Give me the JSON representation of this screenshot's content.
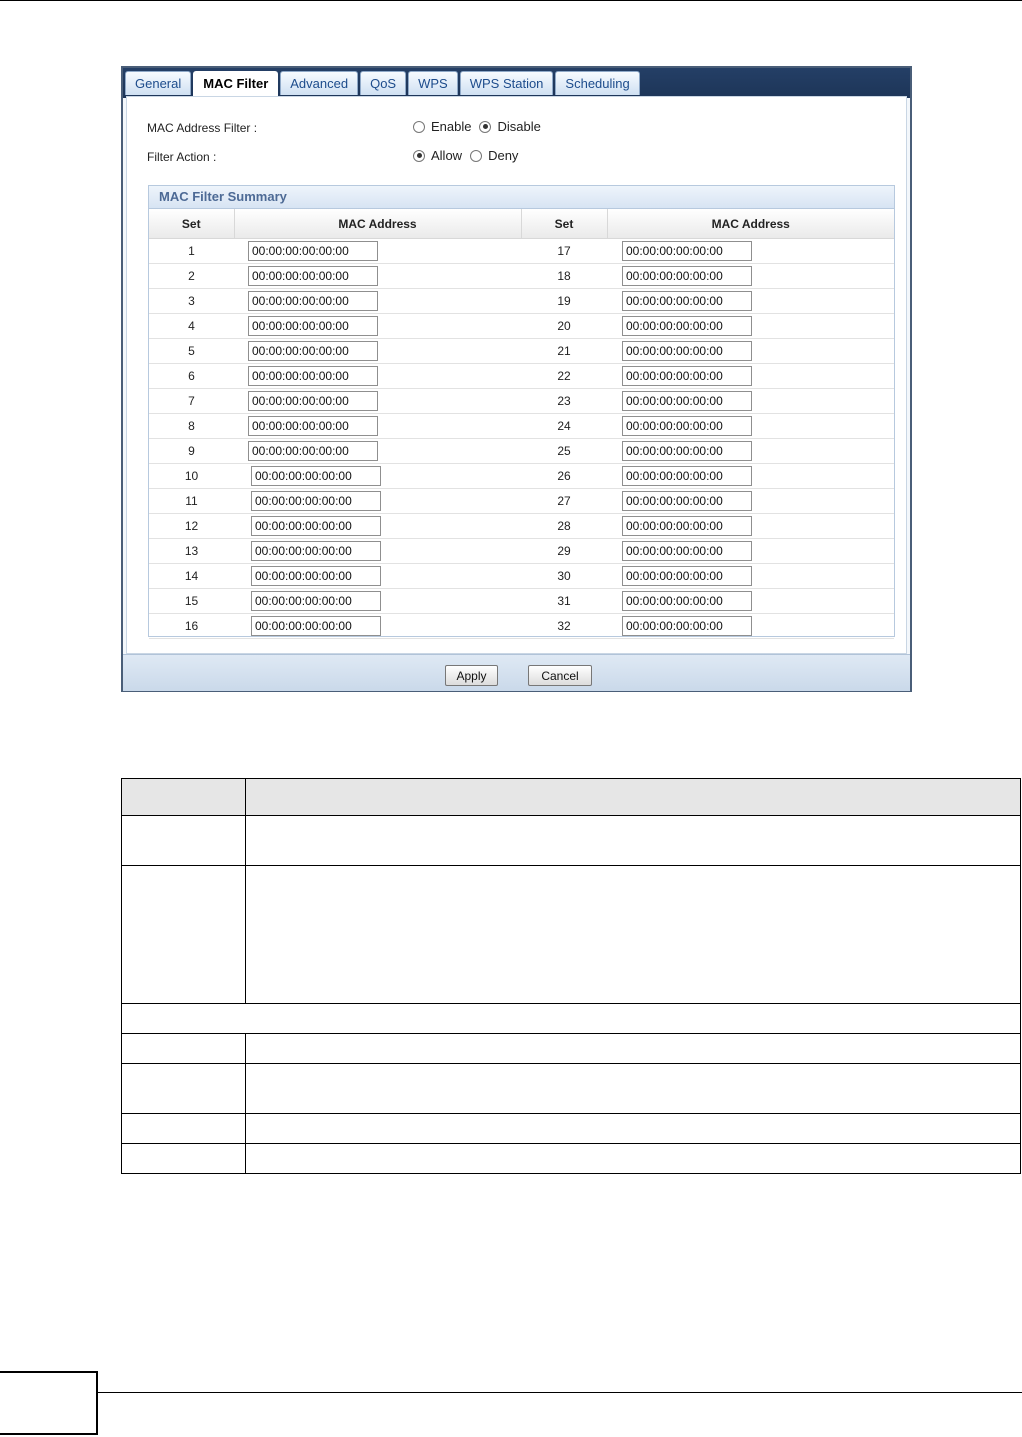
{
  "tabs": [
    "General",
    "MAC Filter",
    "Advanced",
    "QoS",
    "WPS",
    "WPS Station",
    "Scheduling"
  ],
  "active_tab": "MAC Filter",
  "mac_address_filter": {
    "label": "MAC Address Filter :",
    "options": [
      "Enable",
      "Disable"
    ],
    "selected": "Disable"
  },
  "filter_action": {
    "label": "Filter Action :",
    "options": [
      "Allow",
      "Deny"
    ],
    "selected": "Allow"
  },
  "summary": {
    "title": "MAC Filter Summary",
    "headers": [
      "Set",
      "MAC Address",
      "Set",
      "MAC Address"
    ],
    "rows": [
      {
        "left_set": "1",
        "left_mac": "00:00:00:00:00:00",
        "right_set": "17",
        "right_mac": "00:00:00:00:00:00"
      },
      {
        "left_set": "2",
        "left_mac": "00:00:00:00:00:00",
        "right_set": "18",
        "right_mac": "00:00:00:00:00:00"
      },
      {
        "left_set": "3",
        "left_mac": "00:00:00:00:00:00",
        "right_set": "19",
        "right_mac": "00:00:00:00:00:00"
      },
      {
        "left_set": "4",
        "left_mac": "00:00:00:00:00:00",
        "right_set": "20",
        "right_mac": "00:00:00:00:00:00"
      },
      {
        "left_set": "5",
        "left_mac": "00:00:00:00:00:00",
        "right_set": "21",
        "right_mac": "00:00:00:00:00:00"
      },
      {
        "left_set": "6",
        "left_mac": "00:00:00:00:00:00",
        "right_set": "22",
        "right_mac": "00:00:00:00:00:00"
      },
      {
        "left_set": "7",
        "left_mac": "00:00:00:00:00:00",
        "right_set": "23",
        "right_mac": "00:00:00:00:00:00"
      },
      {
        "left_set": "8",
        "left_mac": "00:00:00:00:00:00",
        "right_set": "24",
        "right_mac": "00:00:00:00:00:00"
      },
      {
        "left_set": "9",
        "left_mac": "00:00:00:00:00:00",
        "right_set": "25",
        "right_mac": "00:00:00:00:00:00"
      },
      {
        "left_set": "10",
        "left_mac": "00:00:00:00:00:00",
        "right_set": "26",
        "right_mac": "00:00:00:00:00:00"
      },
      {
        "left_set": "11",
        "left_mac": "00:00:00:00:00:00",
        "right_set": "27",
        "right_mac": "00:00:00:00:00:00"
      },
      {
        "left_set": "12",
        "left_mac": "00:00:00:00:00:00",
        "right_set": "28",
        "right_mac": "00:00:00:00:00:00"
      },
      {
        "left_set": "13",
        "left_mac": "00:00:00:00:00:00",
        "right_set": "29",
        "right_mac": "00:00:00:00:00:00"
      },
      {
        "left_set": "14",
        "left_mac": "00:00:00:00:00:00",
        "right_set": "30",
        "right_mac": "00:00:00:00:00:00"
      },
      {
        "left_set": "15",
        "left_mac": "00:00:00:00:00:00",
        "right_set": "31",
        "right_mac": "00:00:00:00:00:00"
      },
      {
        "left_set": "16",
        "left_mac": "00:00:00:00:00:00",
        "right_set": "32",
        "right_mac": "00:00:00:00:00:00"
      }
    ]
  },
  "buttons": {
    "apply": "Apply",
    "cancel": "Cancel"
  }
}
